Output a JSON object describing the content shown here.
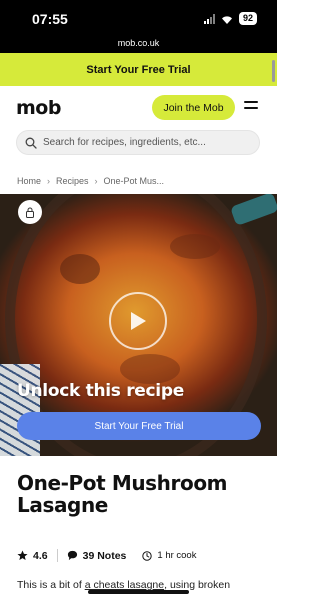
{
  "status_bar": {
    "time": "07:55",
    "battery": "92"
  },
  "url_bar": {
    "url": "mob.co.uk"
  },
  "promo": {
    "label": "Start Your Free Trial"
  },
  "header": {
    "logo": "mob",
    "join_label": "Join the Mob"
  },
  "search": {
    "placeholder": "Search for recipes, ingredients, etc..."
  },
  "breadcrumb": {
    "items": [
      "Home",
      "Recipes",
      "One-Pot Mus..."
    ]
  },
  "hero": {
    "unlock_text": "Unlock this recipe",
    "cta_label": "Start Your Free Trial"
  },
  "recipe": {
    "title": "One-Pot Mushroom Lasagne",
    "rating": "4.6",
    "notes": "39 Notes",
    "cook_time": "1 hr cook",
    "description_start": "This is a bit of ",
    "description_link": "a cheats lasagne",
    "description_end": ", using broken"
  },
  "colors": {
    "accent": "#d6ea3a",
    "cta_blue": "#5a82e8"
  }
}
